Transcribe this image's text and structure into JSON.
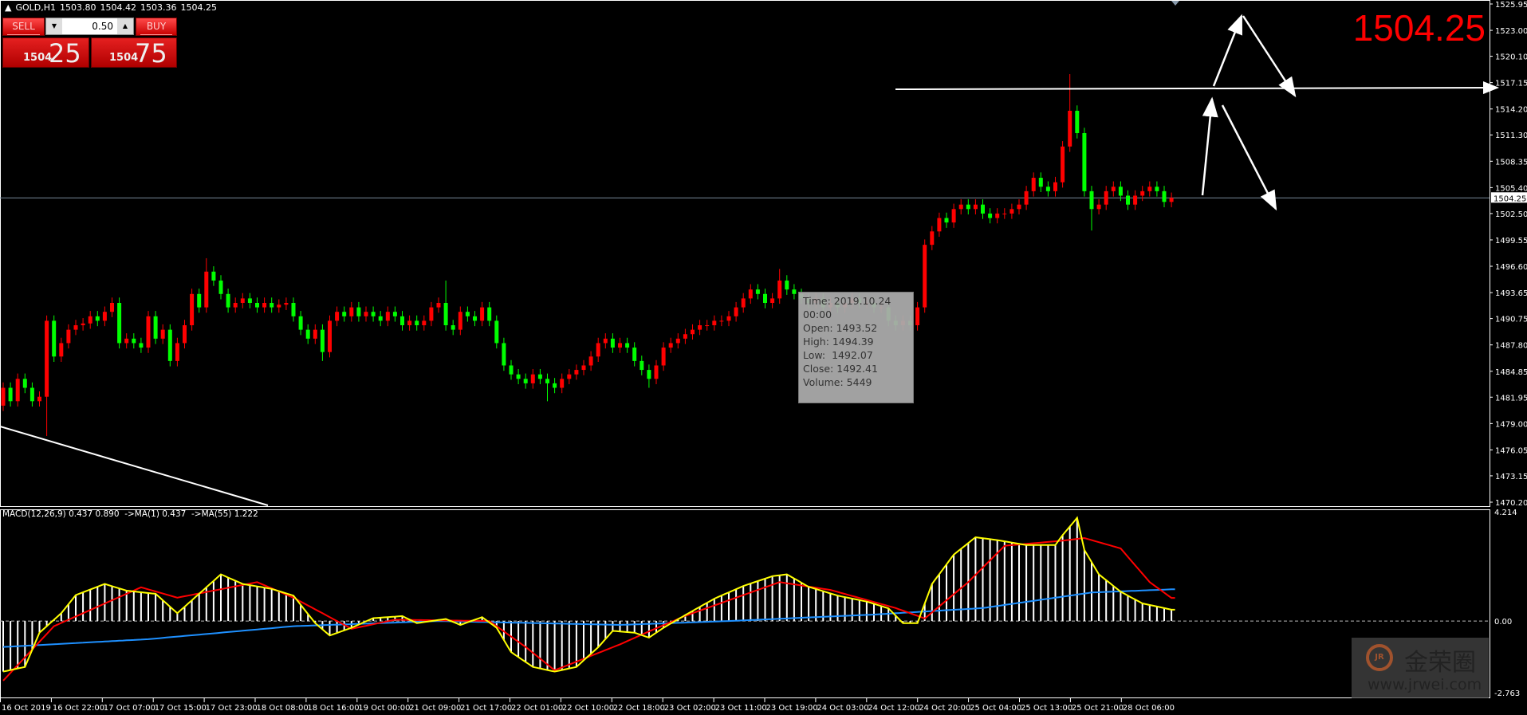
{
  "header": {
    "arrow": "▲",
    "symbol": "GOLD,H1",
    "open": "1503.80",
    "high": "1504.42",
    "low": "1503.36",
    "close": "1504.25"
  },
  "trade_panel": {
    "sell_label": "SELL",
    "buy_label": "BUY",
    "lot_value": "0.50",
    "sell_price_prefix": "1504",
    "sell_price_suffix": "25",
    "buy_price_prefix": "1504",
    "buy_price_suffix": "75"
  },
  "current_price_big": "1504.25",
  "tooltip": {
    "time": "Time: 2019.10.24 00:00",
    "open": "Open: 1493.52",
    "high": "High: 1494.39",
    "low": "Low:  1492.07",
    "close": "Close: 1492.41",
    "volume": "Volume: 5449"
  },
  "macd_label": "MACD(12,26,9) 0.437 0.890  ->MA(1) 0.437  ->MA(55) 1.222",
  "watermark": {
    "brand": "金荣圈",
    "logo_text": "JR",
    "url": "www.jrwei.com"
  },
  "colors": {
    "bull": "#ff0000",
    "bear": "#00ff00",
    "macd_line": "#ffff00",
    "signal_line": "#ff0000",
    "ma55_line": "#1e90ff",
    "histogram": "#ffffff",
    "bid_line": "#778899"
  },
  "chart_data": {
    "type": "candlestick",
    "price_axis": {
      "ylim": [
        1470.2,
        1525.95
      ],
      "tick_labels": [
        "1525.95",
        "1523.00",
        "1520.10",
        "1517.15",
        "1514.20",
        "1511.30",
        "1508.35",
        "1505.40",
        "1502.50",
        "1499.55",
        "1496.60",
        "1493.65",
        "1490.75",
        "1487.80",
        "1484.85",
        "1481.95",
        "1479.00",
        "1476.05",
        "1473.15",
        "1470.20"
      ],
      "current_price": "1504.25"
    },
    "time_axis_labels": [
      "16 Oct 2019",
      "16 Oct 22:00",
      "17 Oct 07:00",
      "17 Oct 15:00",
      "17 Oct 23:00",
      "18 Oct 08:00",
      "18 Oct 16:00",
      "19 Oct 00:00",
      "21 Oct 09:00",
      "21 Oct 17:00",
      "22 Oct 01:00",
      "22 Oct 10:00",
      "22 Oct 18:00",
      "23 Oct 02:00",
      "23 Oct 11:00",
      "23 Oct 19:00",
      "24 Oct 03:00",
      "24 Oct 12:00",
      "24 Oct 20:00",
      "25 Oct 04:00",
      "25 Oct 13:00",
      "25 Oct 21:00",
      "28 Oct 06:00"
    ],
    "first_open": 1481.0,
    "closes": [
      1483.0,
      1481.5,
      1484.0,
      1483.0,
      1481.5,
      1482.0,
      1490.5,
      1486.5,
      1488.0,
      1489.5,
      1490.0,
      1490.2,
      1491.0,
      1490.5,
      1491.5,
      1492.5,
      1488.0,
      1488.5,
      1488.0,
      1487.5,
      1491.0,
      1488.5,
      1489.5,
      1486.0,
      1488.0,
      1490.0,
      1493.5,
      1492.0,
      1496.0,
      1495.0,
      1493.5,
      1492.0,
      1492.5,
      1493.0,
      1492.5,
      1492.0,
      1492.5,
      1492.0,
      1492.3,
      1492.5,
      1491.0,
      1489.5,
      1488.5,
      1489.5,
      1487.0,
      1490.5,
      1491.5,
      1491.0,
      1492.0,
      1491.0,
      1491.5,
      1491.0,
      1490.5,
      1491.5,
      1491.0,
      1490.0,
      1490.5,
      1490.0,
      1490.5,
      1492.0,
      1492.5,
      1490.0,
      1489.5,
      1491.5,
      1491.0,
      1490.5,
      1492.0,
      1490.5,
      1488.0,
      1485.5,
      1484.5,
      1484.0,
      1483.5,
      1484.5,
      1484.0,
      1483.5,
      1483.0,
      1484.0,
      1484.5,
      1485.0,
      1485.5,
      1486.5,
      1488.0,
      1488.5,
      1487.5,
      1488.0,
      1487.5,
      1486.0,
      1485.0,
      1484.0,
      1485.5,
      1487.5,
      1488.0,
      1488.5,
      1489.0,
      1489.5,
      1490.0,
      1490.0,
      1490.5,
      1490.5,
      1491.0,
      1492.0,
      1493.0,
      1494.0,
      1493.5,
      1492.5,
      1493.0,
      1495.0,
      1494.0,
      1493.5,
      1493.0,
      1492.5,
      1493.0,
      1492.0,
      1492.5,
      1492.0,
      1492.5,
      1493.0,
      1492.5,
      1492.5,
      1492.0,
      1492.0,
      1490.5,
      1490.0,
      1490.5,
      1490.0,
      1492.0,
      1499.0,
      1500.5,
      1502.0,
      1501.5,
      1503.0,
      1503.5,
      1503.0,
      1503.5,
      1502.5,
      1502.0,
      1502.5,
      1502.5,
      1503.0,
      1503.5,
      1505.0,
      1506.5,
      1505.5,
      1505.0,
      1506.0,
      1510.0,
      1514.0,
      1511.5,
      1505.0,
      1503.0,
      1503.5,
      1505.0,
      1505.5,
      1504.5,
      1503.5,
      1504.5,
      1505.0,
      1505.5,
      1505.0,
      1503.8,
      1504.25
    ],
    "typical_wick": 0.6,
    "wick_extremes": [
      {
        "bar": 6,
        "low": 1477.6
      },
      {
        "bar": 28,
        "high": 1497.5
      },
      {
        "bar": 44,
        "low": 1486.0
      },
      {
        "bar": 61,
        "high": 1495.0
      },
      {
        "bar": 75,
        "low": 1481.5
      },
      {
        "bar": 89,
        "low": 1483.0
      },
      {
        "bar": 107,
        "high": 1496.3
      },
      {
        "bar": 147,
        "high": 1518.1
      },
      {
        "bar": 150,
        "low": 1500.6
      }
    ],
    "macd_panel": {
      "ylim": [
        -2.763,
        4.214
      ],
      "tick_labels": [
        "4.214",
        "0.00",
        "-2.763"
      ],
      "macd": [
        [
          0,
          -1.95
        ],
        [
          3,
          -1.77
        ],
        [
          5,
          -0.45
        ],
        [
          8,
          0.3
        ],
        [
          10,
          1.0
        ],
        [
          14,
          1.43
        ],
        [
          17,
          1.17
        ],
        [
          21,
          1.05
        ],
        [
          24,
          0.3
        ],
        [
          27,
          1.05
        ],
        [
          30,
          1.8
        ],
        [
          33,
          1.43
        ],
        [
          37,
          1.24
        ],
        [
          40,
          0.98
        ],
        [
          43,
          -0.08
        ],
        [
          45,
          -0.56
        ],
        [
          48,
          -0.26
        ],
        [
          51,
          0.11
        ],
        [
          55,
          0.19
        ],
        [
          57,
          -0.08
        ],
        [
          61,
          0.08
        ],
        [
          63,
          -0.15
        ],
        [
          66,
          0.15
        ],
        [
          68,
          -0.26
        ],
        [
          70,
          -1.2
        ],
        [
          73,
          -1.77
        ],
        [
          76,
          -1.95
        ],
        [
          79,
          -1.77
        ],
        [
          82,
          -1.01
        ],
        [
          84,
          -0.38
        ],
        [
          87,
          -0.45
        ],
        [
          89,
          -0.64
        ],
        [
          91,
          -0.26
        ],
        [
          94,
          0.23
        ],
        [
          98,
          0.86
        ],
        [
          102,
          1.35
        ],
        [
          106,
          1.73
        ],
        [
          108,
          1.8
        ],
        [
          111,
          1.32
        ],
        [
          115,
          0.98
        ],
        [
          119,
          0.75
        ],
        [
          122,
          0.49
        ],
        [
          124,
          -0.08
        ],
        [
          126,
          -0.08
        ],
        [
          128,
          1.43
        ],
        [
          131,
          2.56
        ],
        [
          134,
          3.23
        ],
        [
          137,
          3.12
        ],
        [
          141,
          2.93
        ],
        [
          145,
          2.93
        ],
        [
          146,
          3.31
        ],
        [
          148,
          3.98
        ],
        [
          149,
          2.74
        ],
        [
          151,
          1.8
        ],
        [
          154,
          1.13
        ],
        [
          157,
          0.68
        ],
        [
          161,
          0.437
        ]
      ],
      "signal": [
        [
          0,
          -2.3
        ],
        [
          7,
          -0.2
        ],
        [
          19,
          1.3
        ],
        [
          24,
          0.9
        ],
        [
          35,
          1.5
        ],
        [
          40,
          0.9
        ],
        [
          48,
          -0.3
        ],
        [
          54,
          0.05
        ],
        [
          67,
          0.0
        ],
        [
          72,
          -1.0
        ],
        [
          76,
          -1.9
        ],
        [
          85,
          -0.9
        ],
        [
          89,
          -0.4
        ],
        [
          94,
          0.2
        ],
        [
          107,
          1.5
        ],
        [
          114,
          1.2
        ],
        [
          123,
          0.5
        ],
        [
          127,
          0.1
        ],
        [
          133,
          1.5
        ],
        [
          138,
          2.9
        ],
        [
          146,
          3.1
        ],
        [
          149,
          3.2
        ],
        [
          154,
          2.8
        ],
        [
          158,
          1.5
        ],
        [
          161,
          0.89
        ]
      ],
      "ma55": [
        [
          0,
          -1.0
        ],
        [
          20,
          -0.7
        ],
        [
          40,
          -0.2
        ],
        [
          60,
          0.0
        ],
        [
          85,
          -0.15
        ],
        [
          100,
          0.0
        ],
        [
          120,
          0.25
        ],
        [
          135,
          0.5
        ],
        [
          150,
          1.1
        ],
        [
          161,
          1.222
        ]
      ]
    }
  }
}
